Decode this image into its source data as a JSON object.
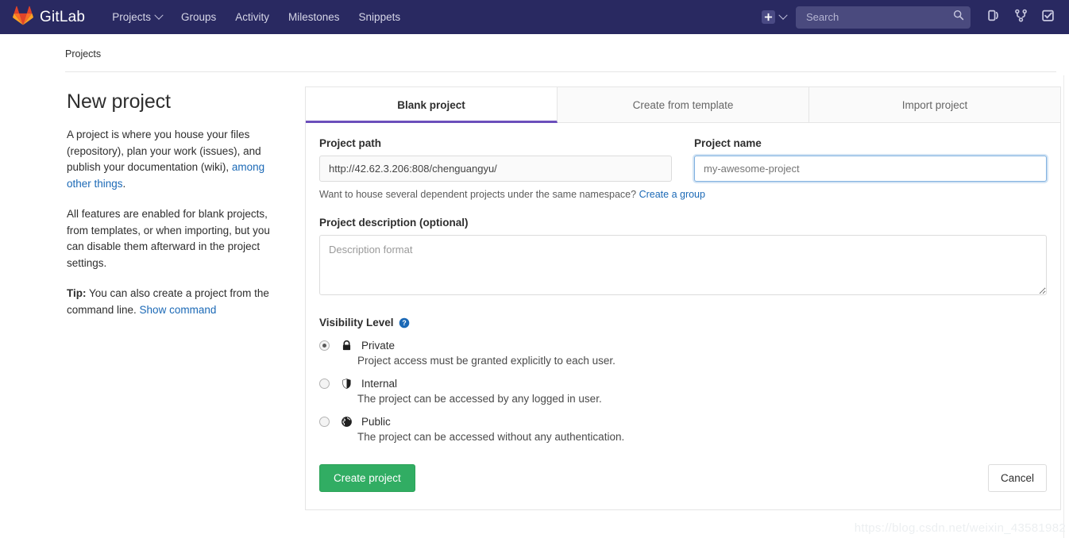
{
  "navbar": {
    "brand": "GitLab",
    "links": [
      {
        "label": "Projects",
        "has_caret": true
      },
      {
        "label": "Groups",
        "has_caret": false
      },
      {
        "label": "Activity",
        "has_caret": false
      },
      {
        "label": "Milestones",
        "has_caret": false
      },
      {
        "label": "Snippets",
        "has_caret": false
      }
    ],
    "new_label": "+",
    "search_placeholder": "Search",
    "search_value": "",
    "icons": [
      "plus-icon",
      "chevron-down-icon",
      "search-icon",
      "issues-icon",
      "merge-requests-icon",
      "todos-icon"
    ],
    "background": "#292961"
  },
  "breadcrumb": {
    "items": [
      "Projects"
    ]
  },
  "intro": {
    "title": "New project",
    "para1_a": "A project is where you house your files (repository), plan your work (issues), and publish your documentation (wiki), ",
    "para1_link": "among other things",
    "para1_b": ".",
    "para2": "All features are enabled for blank projects, from templates, or when importing, but you can disable them afterward in the project settings.",
    "tip_label": "Tip:",
    "tip_text": " You can also create a project from the command line. ",
    "tip_link": "Show command"
  },
  "tabs": [
    {
      "label": "Blank project",
      "active": true
    },
    {
      "label": "Create from template",
      "active": false
    },
    {
      "label": "Import project",
      "active": false
    }
  ],
  "form": {
    "project_path_label": "Project path",
    "project_path_value": "http://42.62.3.206:808/chenguangyu/",
    "project_name_label": "Project name",
    "project_name_value": "",
    "project_name_placeholder": "my-awesome-project",
    "namespace_hint": "Want to house several dependent projects under the same namespace? ",
    "namespace_hint_link": "Create a group",
    "description_label": "Project description (optional)",
    "description_value": "",
    "description_placeholder": "Description format"
  },
  "visibility": {
    "title": "Visibility Level",
    "help_icon": "question-circle-icon",
    "options": [
      {
        "name": "Private",
        "description": "Project access must be granted explicitly to each user.",
        "selected": true,
        "icon": "lock-icon"
      },
      {
        "name": "Internal",
        "description": "The project can be accessed by any logged in user.",
        "selected": false,
        "icon": "shield-icon"
      },
      {
        "name": "Public",
        "description": "The project can be accessed without any authentication.",
        "selected": false,
        "icon": "globe-icon"
      }
    ]
  },
  "actions": {
    "create_label": "Create project",
    "cancel_label": "Cancel",
    "create_color": "#31ad63"
  },
  "watermark": "https://blog.csdn.net/weixin_43581982"
}
